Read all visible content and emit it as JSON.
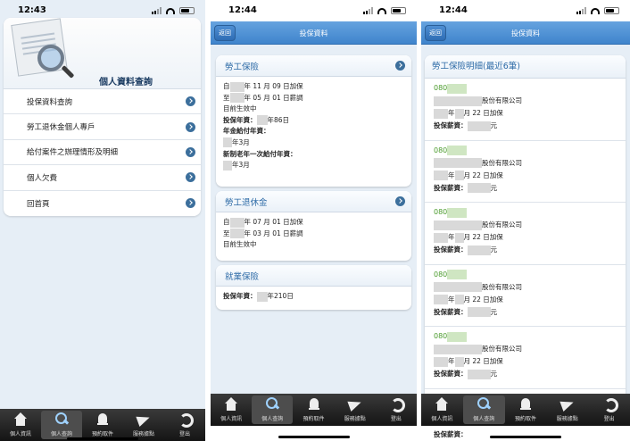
{
  "phone1": {
    "time": "12:43",
    "menu_title": "個人資料查詢",
    "menu_items": [
      "投保資料查詢",
      "勞工退休金個人專戶",
      "給付案件之辦理情形及明細",
      "個人欠費",
      "回首頁"
    ]
  },
  "phone2": {
    "time": "12:44",
    "back_label": "返回",
    "title": "投保資料",
    "labor": {
      "header": "勞工保險",
      "line1_prefix": "自",
      "line1_suffix": "年 11 月 09 日加保",
      "line2_prefix": "至",
      "line2_suffix": "年 05 月 01 日薪調",
      "line3": "目前生效中",
      "years_label": "投保年資：",
      "years_value": "年86日",
      "pension_label": "年金給付年資：",
      "pension_value": "年3月",
      "new_label": "新制老年一次給付年資：",
      "new_value": "年3月"
    },
    "retire": {
      "header": "勞工退休金",
      "line1_prefix": "自",
      "line1_suffix": "年 07 月 01 日加保",
      "line2_prefix": "至",
      "line2_suffix": "年 03 月 01 日薪調",
      "line3": "目前生效中"
    },
    "employment": {
      "header": "就業保險",
      "years_label": "投保年資：",
      "years_value": "年210日"
    }
  },
  "phone3": {
    "time": "12:44",
    "back_label": "返回",
    "title": "投保資料",
    "list_header": "勞工保險明細(最近6筆)",
    "entries": [
      {
        "code": "080",
        "company": "股份有限公司",
        "date_mid": "年",
        "date_suffix": "月 22 日加保",
        "salary_label": "投保薪資：",
        "salary_unit": "元"
      },
      {
        "code": "080",
        "company": "股份有限公司",
        "date_mid": "年",
        "date_suffix": "月 22 日加保",
        "salary_label": "投保薪資：",
        "salary_unit": "元"
      },
      {
        "code": "080",
        "company": "股份有限公司",
        "date_mid": "年",
        "date_suffix": "月 22 日加保",
        "salary_label": "投保薪資：",
        "salary_unit": "元"
      },
      {
        "code": "080",
        "company": "股份有限公司",
        "date_mid": "年",
        "date_suffix": "月 22 日加保",
        "salary_label": "投保薪資：",
        "salary_unit": "元"
      },
      {
        "code": "080",
        "company": "股份有限公司",
        "date_mid": "年",
        "date_suffix": "月 22 日加保",
        "salary_label": "投保薪資：",
        "salary_unit": "元"
      }
    ],
    "trailing_label": "投保薪資："
  },
  "tabbar": {
    "tabs": [
      {
        "label": "個人資訊",
        "icon": "home-icon"
      },
      {
        "label": "個人查詢",
        "icon": "search-icon"
      },
      {
        "label": "預約取件",
        "icon": "bell-icon"
      },
      {
        "label": "服務據點",
        "icon": "send-icon"
      },
      {
        "label": "登出",
        "icon": "refresh-icon"
      }
    ],
    "active_index": 1
  },
  "colors": {
    "navbar": "#4a8fd6",
    "accent_text": "#2c6aa6",
    "code_green": "#4a9b2c",
    "tabbar": "#222222"
  }
}
